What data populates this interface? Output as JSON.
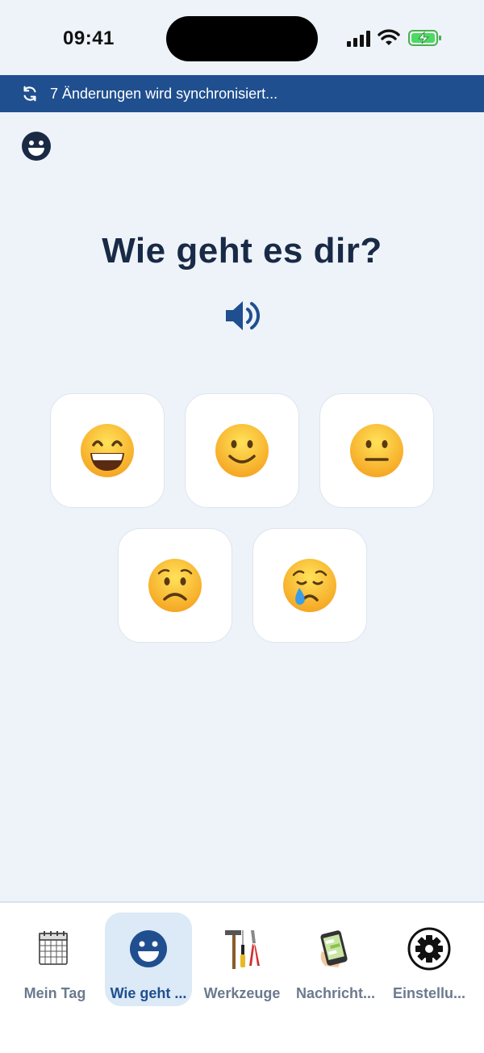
{
  "status_bar": {
    "time": "09:41"
  },
  "sync_banner": {
    "text": "7 Änderungen wird synchronisiert..."
  },
  "main": {
    "question": "Wie geht es dir?"
  },
  "moods": [
    {
      "icon": "grinning-face-icon"
    },
    {
      "icon": "slightly-smiling-face-icon"
    },
    {
      "icon": "neutral-face-icon"
    },
    {
      "icon": "worried-face-icon"
    },
    {
      "icon": "crying-face-icon"
    }
  ],
  "tabs": [
    {
      "label": "Mein Tag",
      "icon": "calendar-icon",
      "active": false
    },
    {
      "label": "Wie geht ...",
      "icon": "smiley-icon",
      "active": true
    },
    {
      "label": "Werkzeuge",
      "icon": "tools-icon",
      "active": false
    },
    {
      "label": "Nachricht...",
      "icon": "phone-message-icon",
      "active": false
    },
    {
      "label": "Einstellu...",
      "icon": "gear-icon",
      "active": false
    }
  ],
  "colors": {
    "banner": "#1f4f8f",
    "background": "#eef3f9",
    "accent": "#1f4f8f",
    "active_tab": "#dce9f6"
  }
}
